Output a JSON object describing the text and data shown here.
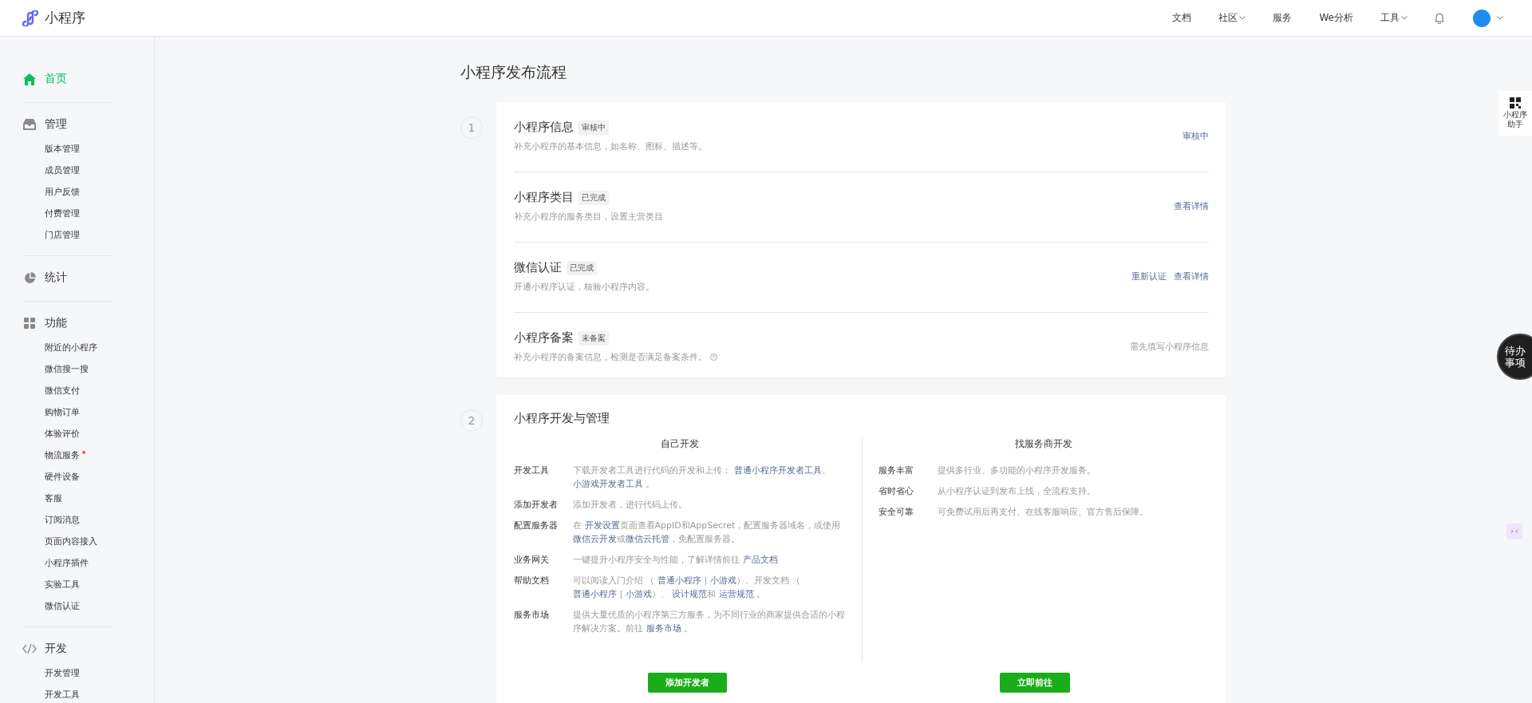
{
  "brand": {
    "name": "小程序"
  },
  "top_nav": [
    {
      "label": "文档",
      "has_caret": false
    },
    {
      "label": "社区",
      "has_caret": true
    },
    {
      "label": "服务",
      "has_caret": false
    },
    {
      "label": "We分析",
      "has_caret": false
    },
    {
      "label": "工具",
      "has_caret": true
    }
  ],
  "sidebar": [
    {
      "label": "首页",
      "selected": true
    },
    {
      "label": "管理",
      "selected": false,
      "items": [
        {
          "label": "版本管理",
          "badge": false
        },
        {
          "label": "成员管理",
          "badge": false
        },
        {
          "label": "用户反馈",
          "badge": false
        },
        {
          "label": "付费管理",
          "badge": false
        },
        {
          "label": "门店管理",
          "badge": false
        }
      ]
    },
    {
      "label": "统计",
      "selected": false
    },
    {
      "label": "功能",
      "selected": false,
      "items": [
        {
          "label": "附近的小程序",
          "badge": false
        },
        {
          "label": "微信搜一搜",
          "badge": false
        },
        {
          "label": "微信支付",
          "badge": false
        },
        {
          "label": "购物订单",
          "badge": false
        },
        {
          "label": "体验评价",
          "badge": false
        },
        {
          "label": "物流服务",
          "badge": true
        },
        {
          "label": "硬件设备",
          "badge": false
        },
        {
          "label": "客服",
          "badge": false
        },
        {
          "label": "订阅消息",
          "badge": false
        },
        {
          "label": "页面内容接入",
          "badge": false
        },
        {
          "label": "小程序插件",
          "badge": false
        },
        {
          "label": "实验工具",
          "badge": false
        },
        {
          "label": "微信认证",
          "badge": false
        }
      ]
    },
    {
      "label": "开发",
      "selected": false,
      "items": [
        {
          "label": "开发管理",
          "badge": false
        },
        {
          "label": "开发工具",
          "badge": false
        }
      ]
    }
  ],
  "page_title": "小程序发布流程",
  "step1": {
    "number": "1",
    "rows": [
      {
        "title": "小程序信息",
        "tag": "审核中",
        "desc": "补充小程序的基本信息，如名称、图标、描述等。",
        "actions": [
          {
            "label": "审核中",
            "kind": "link"
          }
        ]
      },
      {
        "title": "小程序类目",
        "tag": "已完成",
        "desc": "补充小程序的服务类目，设置主营类目",
        "actions": [
          {
            "label": "查看详情",
            "kind": "link"
          }
        ]
      },
      {
        "title": "微信认证",
        "tag": "已完成",
        "desc": "开通小程序认证，核验小程序内容。",
        "actions": [
          {
            "label": "重新认证",
            "kind": "link"
          },
          {
            "label": "查看详情",
            "kind": "link"
          }
        ]
      },
      {
        "title": "小程序备案",
        "tag": "未备案",
        "desc": "补充小程序的备案信息，检测是否满足备案条件。",
        "help": true,
        "actions": [
          {
            "label": "需先填写小程序信息",
            "kind": "note"
          }
        ]
      }
    ]
  },
  "step2": {
    "number": "2",
    "title": "小程序开发与管理",
    "columns": [
      {
        "heading": "自己开发",
        "button": "添加开发者",
        "rows": [
          {
            "label": "开发工具",
            "desc": [
              "下载开发者工具进行代码的开发和上传： ",
              {
                "link": "普通小程序开发者工具"
              },
              "、 ",
              {
                "link": "小游戏开发者工具"
              },
              " 。"
            ]
          },
          {
            "label": "添加开发者",
            "desc": [
              "添加开发者，进行代码上传。"
            ]
          },
          {
            "label": "配置服务器",
            "desc": [
              "在 ",
              {
                "link": "开发设置"
              },
              "页面查看AppID和AppSecret，配置服务器域名，或使用",
              {
                "link": "微信云开发"
              },
              "或",
              {
                "link": "微信云托管"
              },
              "，免配置服务器。"
            ]
          },
          {
            "label": "业务网关",
            "desc": [
              "一键提升小程序安全与性能，了解详情前往 ",
              {
                "link": "产品文档"
              }
            ]
          },
          {
            "label": "帮助文档",
            "desc": [
              "可以阅读入门介绍 （ ",
              {
                "link": "普通小程序"
              },
              " | ",
              {
                "link": "小游戏"
              },
              "）、开发文档 （ ",
              {
                "link": "普通小程序"
              },
              " | ",
              {
                "link": "小游戏"
              },
              "）、 ",
              {
                "link": "设计规范"
              },
              "和 ",
              {
                "link": "运营规范"
              },
              " 。"
            ]
          },
          {
            "label": "服务市场",
            "desc": [
              "提供大量优质的小程序第三方服务，为不同行业的商家提供合适的小程序解决方案。前往 ",
              {
                "link": "服务市场"
              },
              " 。"
            ]
          }
        ]
      },
      {
        "heading": "找服务商开发",
        "button": "立即前往",
        "rows": [
          {
            "label": "服务丰富",
            "desc": [
              "提供多行业、多功能的小程序开发服务。"
            ]
          },
          {
            "label": "省时省心",
            "desc": [
              "从小程序认证到发布上线，全流程支持。"
            ]
          },
          {
            "label": "安全可靠",
            "desc": [
              "可免费试用后再支付、在线客服响应、官方售后保障。"
            ]
          }
        ]
      }
    ]
  },
  "float_helper": {
    "label": "小程序助手"
  },
  "todo": {
    "label": "待办事项"
  }
}
